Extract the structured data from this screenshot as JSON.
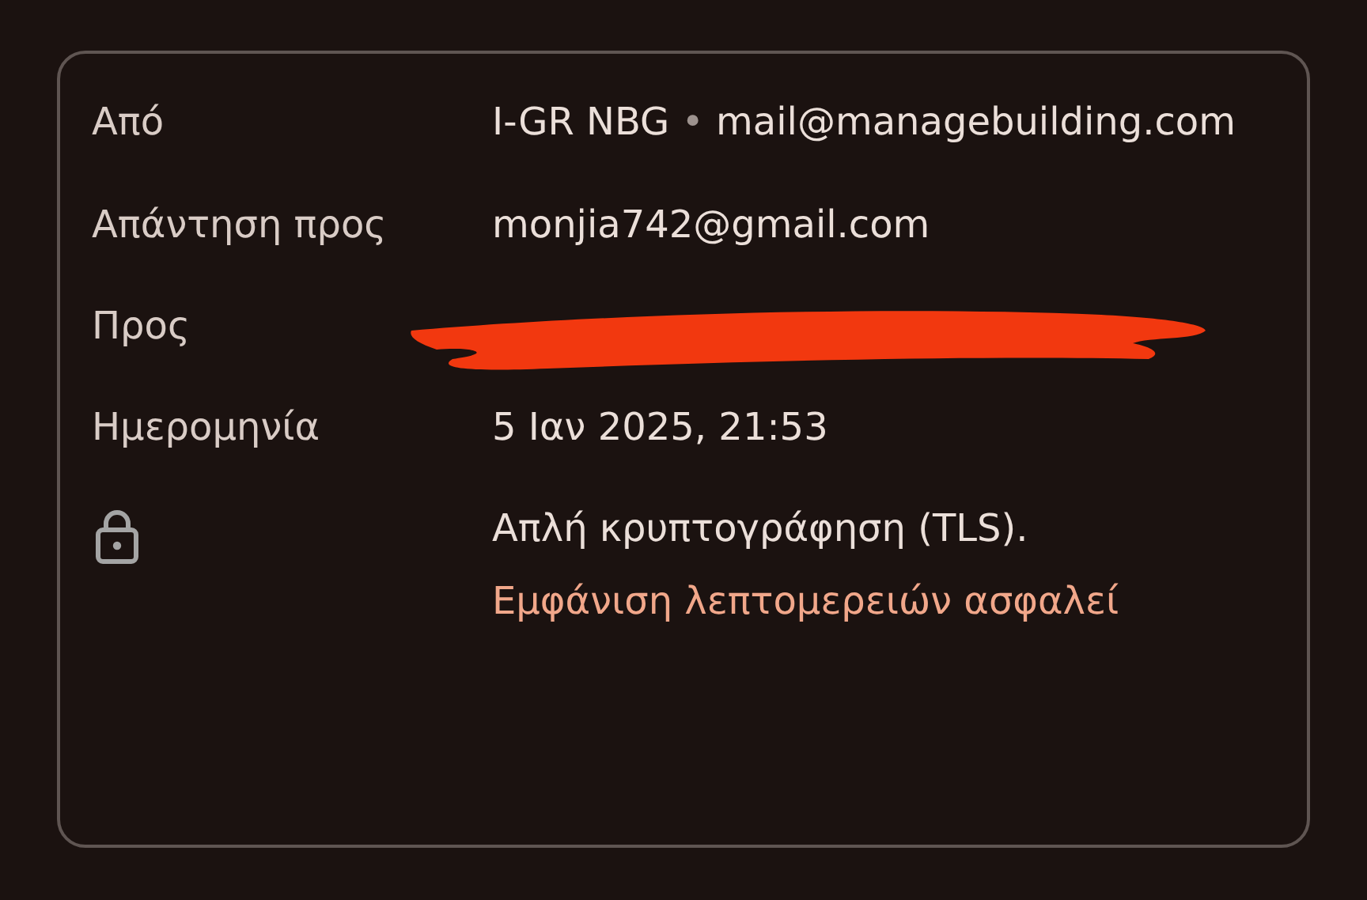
{
  "details": [
    {
      "kind": "sender",
      "label": "Από",
      "name": "I-GR NBG",
      "separator": "•",
      "email": "mail@managebuilding.com"
    },
    {
      "kind": "text",
      "label": "Απάντηση προς",
      "value": "monjia742@gmail.com"
    },
    {
      "kind": "redacted",
      "label": "Προς",
      "redacted": true
    },
    {
      "kind": "text",
      "label": "Ημερομηνία",
      "value": "5 Ιαν 2025, 21:53"
    },
    {
      "kind": "security",
      "value": "Απλή κρυπτογράφηση (TLS).",
      "link": "Εμφάνιση λεπτομερειών ασφαλεί"
    }
  ]
}
